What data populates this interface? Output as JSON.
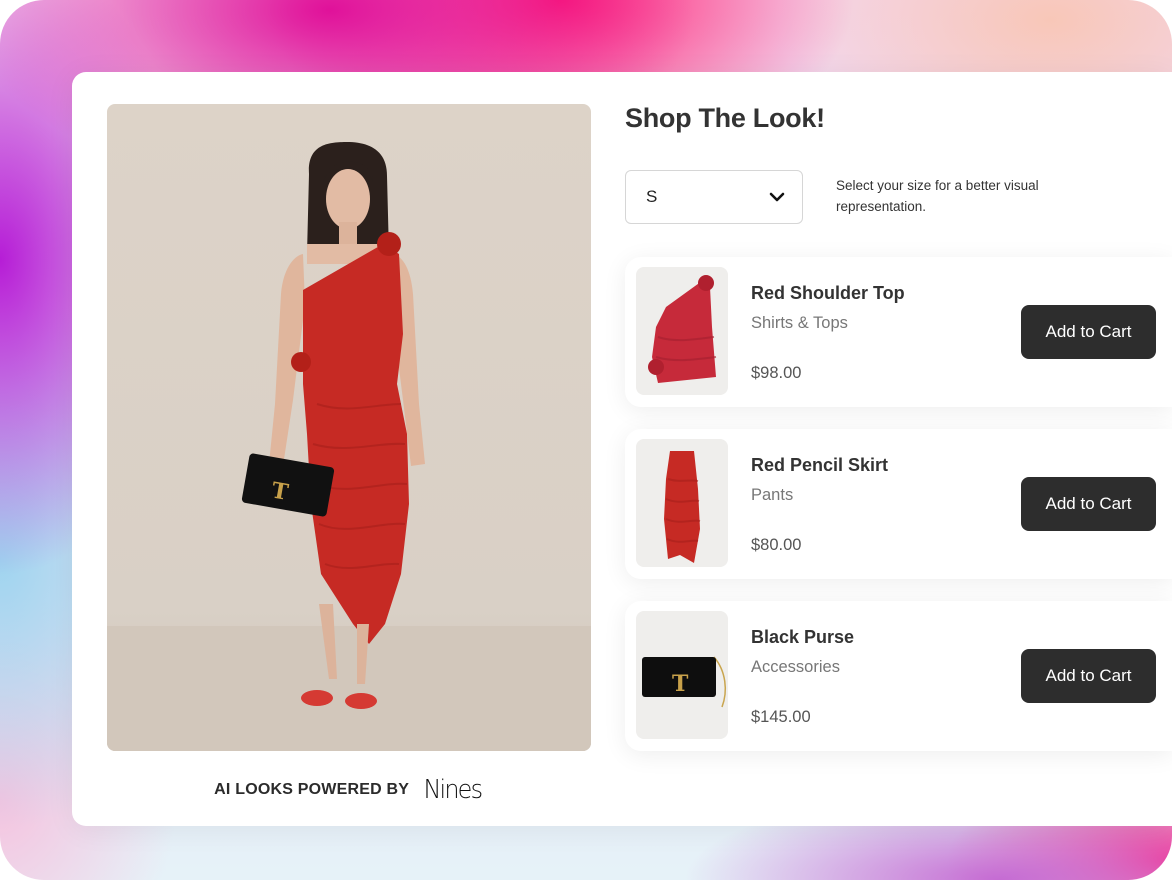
{
  "page": {
    "title": "Shop The Look!",
    "accent_color": "#2d2d2d",
    "product_red": "#c62a24"
  },
  "size_selector": {
    "selected": "S",
    "hint": "Select your size for a better visual representation.",
    "icon": "chevron-down-icon"
  },
  "products": [
    {
      "name": "Red Shoulder Top",
      "category": "Shirts & Tops",
      "price": "$98.00",
      "button_label": "Add to Cart"
    },
    {
      "name": "Red Pencil Skirt",
      "category": "Pants",
      "price": "$80.00",
      "button_label": "Add to Cart"
    },
    {
      "name": "Black Purse",
      "category": "Accessories",
      "price": "$145.00",
      "button_label": "Add to Cart"
    }
  ],
  "footer": {
    "powered_by": "AI LOOKS POWERED BY",
    "brand": "Nines"
  }
}
